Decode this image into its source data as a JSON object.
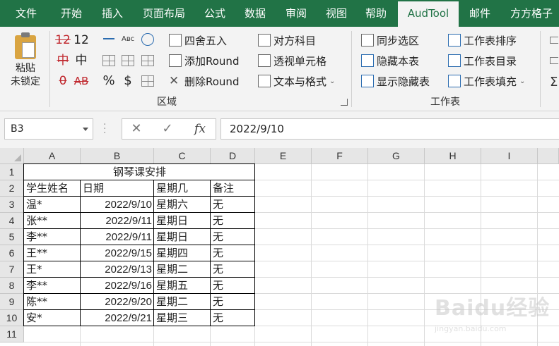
{
  "tabs": [
    {
      "label": "文件",
      "active": false
    },
    {
      "label": "开始",
      "active": false
    },
    {
      "label": "插入",
      "active": false
    },
    {
      "label": "页面布局",
      "active": false
    },
    {
      "label": "公式",
      "active": false
    },
    {
      "label": "数据",
      "active": false
    },
    {
      "label": "审阅",
      "active": false
    },
    {
      "label": "视图",
      "active": false
    },
    {
      "label": "帮助",
      "active": false
    },
    {
      "label": "AudTool",
      "active": true
    },
    {
      "label": "邮件",
      "active": false
    },
    {
      "label": "方方格子",
      "active": false
    }
  ],
  "ribbon": {
    "paste": {
      "line1": "粘贴",
      "line2": "未锁定"
    },
    "font_glyphs": [
      "12",
      "12",
      "中",
      "中",
      "0",
      "AB"
    ],
    "symbol_glyphs": [
      "%",
      "$"
    ],
    "round_buttons": [
      "四舍五入",
      "添加Round",
      "删除Round"
    ],
    "subject_buttons": [
      "对方科目",
      "透视单元格",
      "文本与格式"
    ],
    "region_label": "区域",
    "sheet_buttons_left": [
      "同步选区",
      "隐藏本表",
      "显示隐藏表"
    ],
    "sheet_buttons_right": [
      "工作表排序",
      "工作表目录",
      "工作表填充"
    ],
    "sheet_label": "工作表",
    "accent_color": "#217346"
  },
  "formula_bar": {
    "name_box": "B3",
    "fx_label": "fx",
    "content": "2022/9/10"
  },
  "sheet": {
    "columns": [
      "A",
      "B",
      "C",
      "D",
      "E",
      "F",
      "G",
      "H",
      "I"
    ],
    "rows": [
      "1",
      "2",
      "3",
      "4",
      "5",
      "6",
      "7",
      "8",
      "9",
      "10",
      "11"
    ],
    "title": "钢琴课安排",
    "headers": [
      "学生姓名",
      "日期",
      "星期几",
      "备注"
    ],
    "data": [
      [
        "温*",
        "2022/9/10",
        "星期六",
        "无"
      ],
      [
        "张**",
        "2022/9/11",
        "星期日",
        "无"
      ],
      [
        "李**",
        "2022/9/11",
        "星期日",
        "无"
      ],
      [
        "王**",
        "2022/9/15",
        "星期四",
        "无"
      ],
      [
        "王*",
        "2022/9/13",
        "星期二",
        "无"
      ],
      [
        "李**",
        "2022/9/16",
        "星期五",
        "无"
      ],
      [
        "陈**",
        "2022/9/20",
        "星期二",
        "无"
      ],
      [
        "安*",
        "2022/9/21",
        "星期三",
        "无"
      ]
    ]
  },
  "watermark": {
    "brand": "Baidu经验",
    "url": "jingyan.baidu.com"
  }
}
